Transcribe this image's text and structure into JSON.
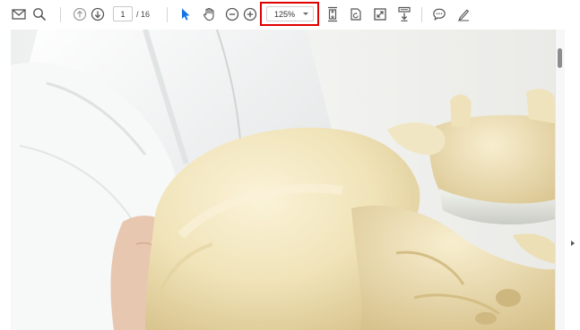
{
  "toolbar": {
    "icons": {
      "email": "envelope-icon",
      "search": "magnifier-icon",
      "prev_page": "arrow-up-circle-icon",
      "next_page": "arrow-down-circle-icon",
      "select_tool": "cursor-arrow-icon",
      "hand_tool": "hand-icon",
      "zoom_out": "minus-circle-icon",
      "zoom_in": "plus-circle-icon",
      "fit_page": "fit-page-icon",
      "rotate": "rotate-page-icon",
      "full_screen": "full-screen-icon",
      "scroll_mode": "scroll-mode-icon",
      "comment": "speech-bubble-icon",
      "highlight": "pen-icon"
    },
    "page_input_value": "1",
    "page_total": "/ 16",
    "zoom_value": "125%"
  },
  "colors": {
    "accent_blue": "#1473e6",
    "highlight_red": "#e00000",
    "icon_gray": "#555555"
  },
  "document": {
    "image_subject": "pelvis-bone-model-photo"
  }
}
